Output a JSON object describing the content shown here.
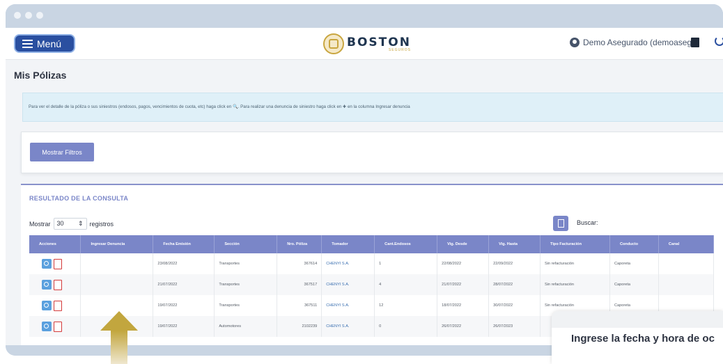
{
  "navbar": {
    "menu_label": "Menú",
    "logo_main": "BOSTON",
    "logo_sub": "SEGUROS",
    "user": "Demo Asegurado (demoaseg)"
  },
  "page": {
    "title": "Mis Pólizas",
    "info_text": "Para ver el detalle de la póliza o sus siniestros (endosos, pagos, vencimientos de cuota, etc) haga click en 🔍. Para realizar una denuncia de siniestro haga click en ✚ en la columna Ingresar denuncia"
  },
  "filters": {
    "button_label": "Mostrar Filtros"
  },
  "result": {
    "title": "RESULTADO DE LA CONSULTA",
    "show_label": "Mostrar",
    "show_value": "30",
    "records_label": "registros",
    "search_label": "Buscar:"
  },
  "table": {
    "headers": [
      "Acciones",
      "Ingresar Denuncia",
      "Fecha Emisión",
      "Sección",
      "Nro. Póliza",
      "Tomador",
      "Cant.Endosos",
      "Vig. Desde",
      "Vig. Hasta",
      "Tipo Facturación",
      "Conducto",
      "Canal"
    ],
    "rows": [
      {
        "fecha": "23/08/2022",
        "seccion": "Transportes",
        "poliza": "367614",
        "tomador": "CHENYI S.A.",
        "endosos": "1",
        "desde": "22/08/2022",
        "hasta": "22/09/2022",
        "tipo": "Sin refacturación",
        "conducto": "Caporeta",
        "canal": ""
      },
      {
        "fecha": "21/07/2022",
        "seccion": "Transportes",
        "poliza": "367517",
        "tomador": "CHENYI S.A.",
        "endosos": "4",
        "desde": "21/07/2022",
        "hasta": "28/07/2022",
        "tipo": "Sin refacturación",
        "conducto": "Caporeta",
        "canal": ""
      },
      {
        "fecha": "19/07/2022",
        "seccion": "Transportes",
        "poliza": "367511",
        "tomador": "CHENYI S.A.",
        "endosos": "12",
        "desde": "18/07/2022",
        "hasta": "30/07/2022",
        "tipo": "Sin refacturación",
        "conducto": "Caporeta",
        "canal": ""
      },
      {
        "fecha": "19/07/2022",
        "seccion": "Automotores",
        "poliza": "2102239",
        "tomador": "CHENYI S.A.",
        "endosos": "0",
        "desde": "26/07/2022",
        "hasta": "26/07/2023",
        "tipo": "",
        "conducto": "",
        "canal": ""
      }
    ]
  },
  "modal": {
    "title": "Ingrese la fecha y hora de oc"
  },
  "colors": {
    "accent": "#7a86c8",
    "menu": "#2a4fa0",
    "arrow": "#c2a63e"
  }
}
